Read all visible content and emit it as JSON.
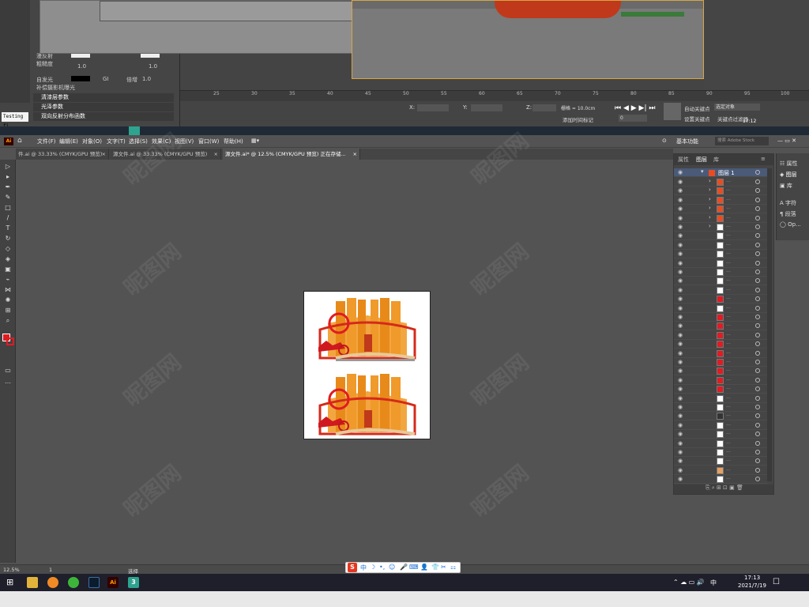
{
  "max": {
    "material_rows": [
      "漫反射",
      "粗糙度",
      "深度（cm）",
      "自发光"
    ],
    "material_values": [
      "1.0",
      "1.0"
    ],
    "color_label": "颜色",
    "gi_label": "GI",
    "mult_label": "倍增",
    "mult_value": "1.0",
    "fog_label": "补偿摄影机曝光",
    "sections": [
      "清漆层参数",
      "光泽参数",
      "双向反射分布函数"
    ],
    "timeline_ticks": [
      "25",
      "30",
      "35",
      "40",
      "45",
      "50",
      "55",
      "60",
      "65",
      "70",
      "75",
      "80",
      "85",
      "90",
      "95",
      "100"
    ],
    "grid_label": "栅格 = 10.0cm",
    "add_time_tag": "添加时间标记",
    "auto_key": "自动关键点",
    "selected_object": "选定对象",
    "set_key": "设置关键点",
    "key_filter": "关键点过滤器",
    "frame_value": "0",
    "axis_labels": [
      "X:",
      "Y:",
      "Z:"
    ],
    "clock_time": "17:12",
    "testing_text": "Testing fi"
  },
  "ai": {
    "menu": [
      "文件(F)",
      "编辑(E)",
      "对象(O)",
      "文字(T)",
      "选择(S)",
      "效果(C)",
      "视图(V)",
      "窗口(W)",
      "帮助(H)"
    ],
    "workspace": "基本功能",
    "search_placeholder": "搜索 Adobe Stock",
    "tabs": [
      {
        "label": "件.ai @ 33.33% (CMYK/GPU 预览)",
        "close": "×"
      },
      {
        "label": "源文件.ai @ 33.33% (CMYK/GPU 预览)",
        "close": "×"
      },
      {
        "label": "源文件.ai* @ 12.5% (CMYK/GPU 预览) 正在存储...",
        "close": "×"
      }
    ],
    "layers_tabs": [
      "属性",
      "图层",
      "库"
    ],
    "layer_name": "图层 1",
    "layer_dots": "...",
    "props": [
      "属性",
      "图层",
      "库",
      "字符",
      "段落",
      "Op..."
    ],
    "zoom": "12.5%",
    "page": "1",
    "status": "选择"
  },
  "taskbar": {
    "time": "17:13",
    "date": "2021/7/19",
    "lang": "中"
  },
  "ime": {
    "logo": "S",
    "items": [
      "中",
      "☽",
      "•,",
      "☺",
      "🎤",
      "⌨",
      "👤",
      "👕",
      "✂",
      "⚏"
    ]
  },
  "watermark": "昵图网",
  "colors": {
    "accent": "#e84c22",
    "orange": "#e88a1a",
    "red": "#e01b22"
  }
}
